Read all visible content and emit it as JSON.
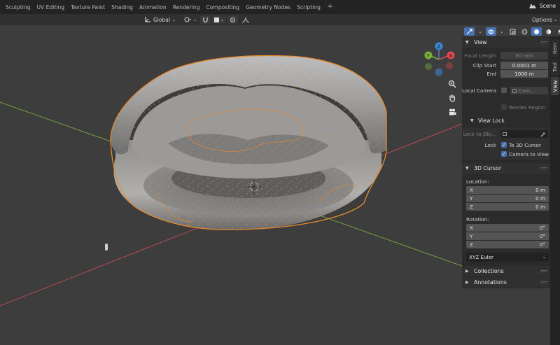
{
  "workspace_tabs": [
    "Sculpting",
    "UV Editing",
    "Texture Paint",
    "Shading",
    "Animation",
    "Rendering",
    "Compositing",
    "Geometry Nodes",
    "Scripting"
  ],
  "add_tab": "+",
  "scene": {
    "label": "Scene"
  },
  "viewport_header": {
    "transform_orientation": "Global",
    "options_label": "Options"
  },
  "sidebar_tabs": [
    "Item",
    "Tool",
    "View"
  ],
  "active_sidebar_tab": "View",
  "view_panel": {
    "title": "View",
    "focal_length_label": "Focal Length",
    "focal_length_value": "50 mm",
    "clip_start_label": "Clip Start",
    "clip_start_value": "0.0001 m",
    "end_label": "End",
    "end_value": "1000 m",
    "local_camera_label": "Local Camera",
    "local_camera_value": "Cam...",
    "render_region_label": "Render Region",
    "view_lock_title": "View Lock",
    "lock_to_object_label": "Lock to Obj...",
    "lock_label": "Lock",
    "to_3d_cursor_label": "To 3D Cursor",
    "camera_to_view_label": "Camera to View"
  },
  "cursor_panel": {
    "title": "3D Cursor",
    "location_label": "Location:",
    "location": [
      {
        "axis": "X",
        "value": "0 m"
      },
      {
        "axis": "Y",
        "value": "0 m"
      },
      {
        "axis": "Z",
        "value": "0 m"
      }
    ],
    "rotation_label": "Rotation:",
    "rotation": [
      {
        "axis": "X",
        "value": "0°"
      },
      {
        "axis": "Y",
        "value": "0°"
      },
      {
        "axis": "Z",
        "value": "0°"
      }
    ],
    "rotation_mode": "XYZ Euler"
  },
  "collapsed_panels": [
    "Collections",
    "Annotations"
  ],
  "gizmo": {
    "x": "X",
    "y": "Y",
    "z": "Z"
  },
  "colors": {
    "accent_blue": "#4772b3",
    "selection_orange": "#e98a2c",
    "x_axis_red": "#c94a55",
    "y_axis_green": "#77a83c",
    "gizmo_x": "#e04651",
    "gizmo_y": "#79b23a",
    "gizmo_z": "#3d87d8"
  }
}
